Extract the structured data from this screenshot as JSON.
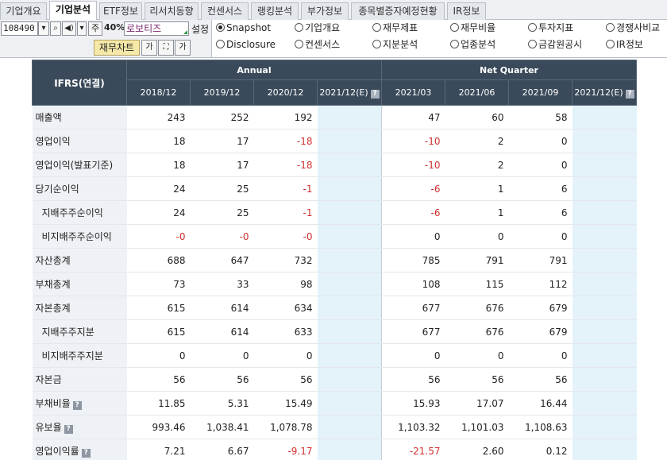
{
  "tabs": [
    {
      "label": "기업개요",
      "active": false
    },
    {
      "label": "기업분석",
      "active": true
    },
    {
      "label": "ETF정보",
      "active": false
    },
    {
      "label": "리서치동향",
      "active": false
    },
    {
      "label": "컨센서스",
      "active": false
    },
    {
      "label": "랭킹분석",
      "active": false
    },
    {
      "label": "부가정보",
      "active": false
    },
    {
      "label": "종목별증자예정현황",
      "active": false
    },
    {
      "label": "IR정보",
      "active": false
    }
  ],
  "toolbar": {
    "stock_code": "108490",
    "zoom": "40%",
    "stock_name": "로보티즈",
    "setting_label": "설정",
    "mode_label": "주",
    "chart_button": "재무차트",
    "icons": [
      "chevron-down-icon",
      "speaker-icon",
      "chevron-down-icon",
      "ga-text-icon",
      "fit-screen-icon",
      "ga-print-icon"
    ]
  },
  "radio_options": [
    {
      "label": "Snapshot",
      "checked": true
    },
    {
      "label": "기업개요",
      "checked": false
    },
    {
      "label": "재무제표",
      "checked": false
    },
    {
      "label": "재무비율",
      "checked": false
    },
    {
      "label": "투자지표",
      "checked": false
    },
    {
      "label": "경쟁사비교",
      "checked": false
    },
    {
      "label": "Disclosure",
      "checked": false
    },
    {
      "label": "컨센서스",
      "checked": false
    },
    {
      "label": "지분분석",
      "checked": false
    },
    {
      "label": "업종분석",
      "checked": false
    },
    {
      "label": "금감원공시",
      "checked": false
    },
    {
      "label": "IR정보",
      "checked": false
    }
  ],
  "table": {
    "label_header": "IFRS(연결)",
    "group_annual": "Annual",
    "group_quarter": "Net Quarter",
    "periods": [
      "2018/12",
      "2019/12",
      "2020/12",
      "2021/12(E)",
      "2021/03",
      "2021/06",
      "2021/09",
      "2021/12(E)"
    ],
    "rows": [
      {
        "label": "매출액",
        "indent": false,
        "help": false,
        "values": [
          "243",
          "252",
          "192",
          "",
          "47",
          "60",
          "58",
          ""
        ]
      },
      {
        "label": "영업이익",
        "indent": false,
        "help": false,
        "values": [
          "18",
          "17",
          "-18",
          "",
          "-10",
          "2",
          "0",
          ""
        ]
      },
      {
        "label": "영업이익(발표기준)",
        "indent": false,
        "help": false,
        "values": [
          "18",
          "17",
          "-18",
          "",
          "-10",
          "2",
          "0",
          ""
        ]
      },
      {
        "label": "당기순이익",
        "indent": false,
        "help": false,
        "values": [
          "24",
          "25",
          "-1",
          "",
          "-6",
          "1",
          "6",
          ""
        ]
      },
      {
        "label": "지배주주순이익",
        "indent": true,
        "help": false,
        "values": [
          "24",
          "25",
          "-1",
          "",
          "-6",
          "1",
          "6",
          ""
        ]
      },
      {
        "label": "비지배주주순이익",
        "indent": true,
        "help": false,
        "values": [
          "-0",
          "-0",
          "-0",
          "",
          "0",
          "0",
          "0",
          ""
        ]
      },
      {
        "label": "자산총계",
        "indent": false,
        "help": false,
        "values": [
          "688",
          "647",
          "732",
          "",
          "785",
          "791",
          "791",
          ""
        ]
      },
      {
        "label": "부채총계",
        "indent": false,
        "help": false,
        "values": [
          "73",
          "33",
          "98",
          "",
          "108",
          "115",
          "112",
          ""
        ]
      },
      {
        "label": "자본총계",
        "indent": false,
        "help": false,
        "values": [
          "615",
          "614",
          "634",
          "",
          "677",
          "676",
          "679",
          ""
        ]
      },
      {
        "label": "지배주주지분",
        "indent": true,
        "help": false,
        "values": [
          "615",
          "614",
          "633",
          "",
          "677",
          "676",
          "679",
          ""
        ]
      },
      {
        "label": "비지배주주지분",
        "indent": true,
        "help": false,
        "values": [
          "0",
          "0",
          "0",
          "",
          "0",
          "0",
          "0",
          ""
        ]
      },
      {
        "label": "자본금",
        "indent": false,
        "help": false,
        "values": [
          "56",
          "56",
          "56",
          "",
          "56",
          "56",
          "56",
          ""
        ]
      },
      {
        "label": "부채비율",
        "indent": false,
        "help": true,
        "values": [
          "11.85",
          "5.31",
          "15.49",
          "",
          "15.93",
          "17.07",
          "16.44",
          ""
        ]
      },
      {
        "label": "유보율",
        "indent": false,
        "help": true,
        "values": [
          "993.46",
          "1,038.41",
          "1,078.78",
          "",
          "1,103.32",
          "1,101.03",
          "1,108.63",
          ""
        ]
      },
      {
        "label": "영업이익률",
        "indent": false,
        "help": true,
        "values": [
          "7.21",
          "6.67",
          "-9.17",
          "",
          "-21.57",
          "2.60",
          "0.12",
          ""
        ]
      }
    ]
  },
  "colors": {
    "header_bg": "#3a4a5a",
    "label_bg": "#eef1f5",
    "estimate_bg": "#e4f2fa",
    "negative": "#d23030",
    "chart_button_bg": "#f5e8a8"
  }
}
